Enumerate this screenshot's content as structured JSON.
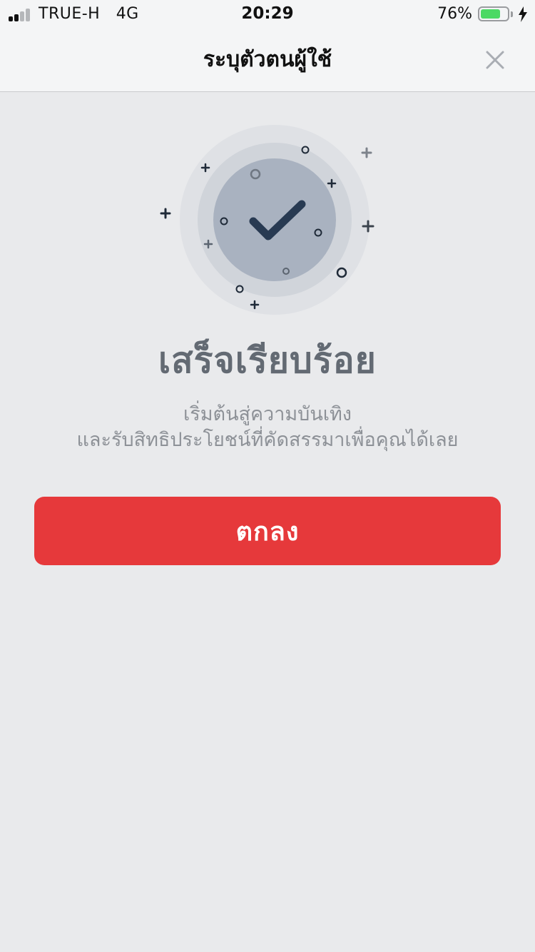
{
  "status_bar": {
    "carrier": "TRUE-H   4G",
    "time": "20:29",
    "battery_percent": "76%",
    "battery_level": 0.76,
    "battery_color": "#4cd964"
  },
  "nav": {
    "title": "ระบุตัวตนผู้ใช้",
    "close_icon": "close-icon"
  },
  "success": {
    "icon": "checkmark-icon",
    "title": "เสร็จเรียบร้อย",
    "subtitle_line1": "เริ่มต้นสู่ความบันเทิง",
    "subtitle_line2": "และรับสิทธิประโยชน์ที่คัดสรรมาเพื่อคุณได้เลย"
  },
  "actions": {
    "ok_label": "ตกลง",
    "ok_color": "#e6393b"
  }
}
